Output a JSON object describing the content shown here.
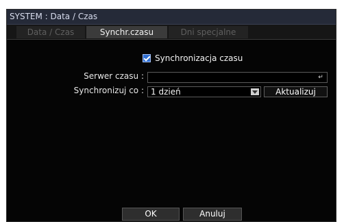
{
  "title": "SYSTEM : Data / Czas",
  "tabs": [
    {
      "label": "Data / Czas",
      "state": "inactive"
    },
    {
      "label": "Synchr.czasu",
      "state": "active"
    },
    {
      "label": "Dni specjalne",
      "state": "inactive"
    }
  ],
  "sync_enabled": {
    "label": "Synchronizacja czasu",
    "checked": true
  },
  "server": {
    "label": "Serwer czasu :",
    "value": ""
  },
  "sync_interval": {
    "label": "Synchronizuj co :",
    "value": "1 dzień"
  },
  "buttons": {
    "update": "Aktualizuj",
    "ok": "OK",
    "cancel": "Anuluj"
  },
  "icons": {
    "enter": "↵"
  },
  "colors": {
    "title_bg": "#252a38",
    "checkbox": "#2f6fd3"
  }
}
